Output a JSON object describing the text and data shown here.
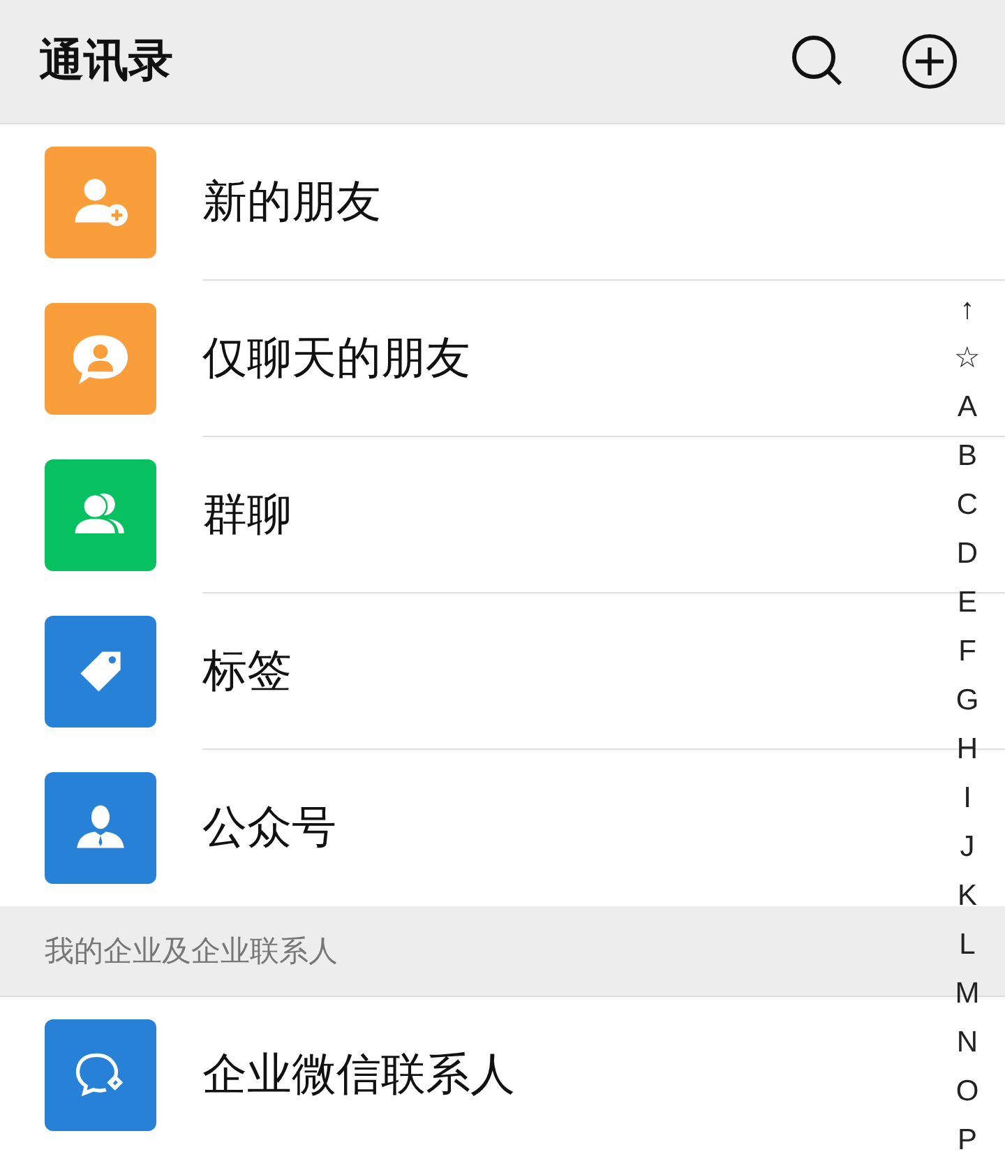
{
  "header": {
    "title": "通讯录"
  },
  "items": [
    {
      "kind": "add-person",
      "color": "#fa9d3b",
      "label": "新的朋友"
    },
    {
      "kind": "chat-person",
      "color": "#fa9d3b",
      "label": "仅聊天的朋友"
    },
    {
      "kind": "group",
      "color": "#07c160",
      "label": "群聊"
    },
    {
      "kind": "tag",
      "color": "#2782d7",
      "label": "标签"
    },
    {
      "kind": "official",
      "color": "#2782d7",
      "label": "公众号"
    }
  ],
  "section": {
    "title": "我的企业及企业联系人"
  },
  "section_items": [
    {
      "kind": "enterprise",
      "color": "#2782d7",
      "label": "企业微信联系人"
    }
  ],
  "index": [
    "↑",
    "☆",
    "A",
    "B",
    "C",
    "D",
    "E",
    "F",
    "G",
    "H",
    "I",
    "J",
    "K",
    "L",
    "M",
    "N",
    "O",
    "P"
  ]
}
